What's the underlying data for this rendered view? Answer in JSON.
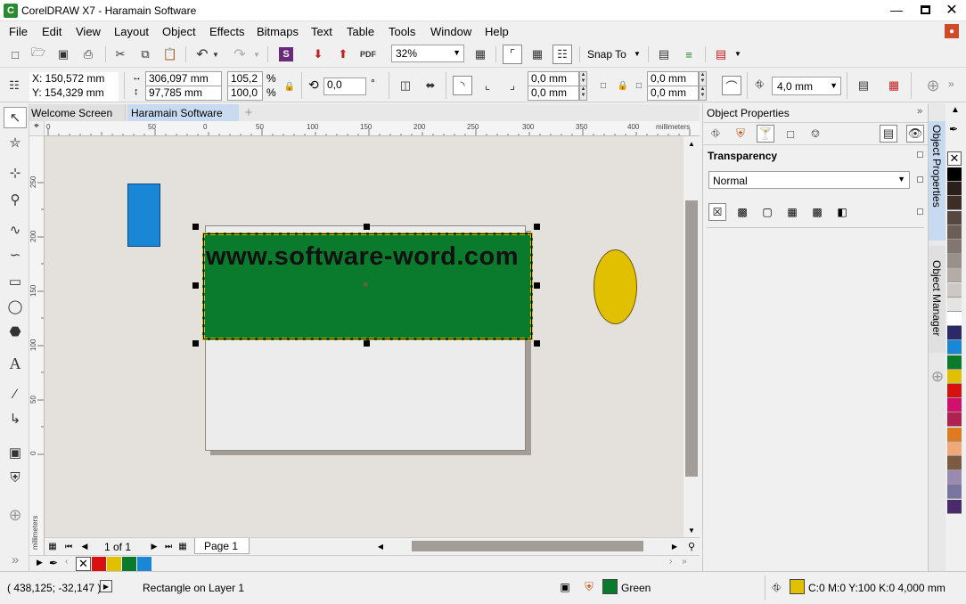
{
  "window": {
    "title": "CorelDRAW X7 - Haramain Software"
  },
  "menu": [
    "File",
    "Edit",
    "View",
    "Layout",
    "Object",
    "Effects",
    "Bitmaps",
    "Text",
    "Table",
    "Tools",
    "Window",
    "Help"
  ],
  "toolbar": {
    "zoom": "32%",
    "snap_to": "Snap To"
  },
  "propbar": {
    "x": "X: 150,572 mm",
    "y": "Y: 154,329 mm",
    "width": "306,097 mm",
    "height": "97,785 mm",
    "scale_w": "105,2",
    "scale_h": "100,0",
    "pct1": "%",
    "pct2": "%",
    "angle": "0,0",
    "deg": "°",
    "corner1": "0,0 mm",
    "corner2": "0,0 mm",
    "corner3": "0,0 mm",
    "corner4": "0,0 mm",
    "outline": "4,0 mm"
  },
  "doc_tabs": [
    "Welcome Screen",
    "Haramain Software"
  ],
  "ruler": {
    "unit": "millimeters",
    "h_ticks": [
      "0",
      "50",
      "0",
      "50",
      "100",
      "150",
      "200",
      "250",
      "300",
      "350",
      "400"
    ],
    "v_ticks": [
      "250",
      "200",
      "150",
      "100",
      "50",
      "0"
    ]
  },
  "canvas": {
    "text_object": "www.software-word.com"
  },
  "page_nav": {
    "count": "1 of 1",
    "page_tab": "Page 1"
  },
  "docker": {
    "title": "Object Properties",
    "section": "Transparency",
    "mode": "Normal",
    "side_tabs": [
      "Object Properties",
      "Object Manager"
    ]
  },
  "status": {
    "coords": "( 438,125; -32,147 )",
    "object": "Rectangle on Layer 1",
    "fill_name": "Green",
    "outline_info": "C:0 M:0 Y:100 K:0  4,000 mm"
  },
  "colors": {
    "green": "#0a7a2c",
    "blue": "#1a87d6",
    "yellow": "#e0c000",
    "red": "#d81010",
    "tab_active": "#c8daf0",
    "palette": [
      "#000000",
      "#2b1f1a",
      "#3d2f28",
      "#564840",
      "#6b5e57",
      "#827670",
      "#9a908a",
      "#b3aca7",
      "#cdc8c5",
      "#e6e4e2",
      "#ffffff",
      "#2a2a6a",
      "#1a87d6",
      "#0a7a2c",
      "#e0c000",
      "#d81010",
      "#d0106a",
      "#b02050",
      "#e07a1e",
      "#f0a878",
      "#7a5a40",
      "#9a8ab0",
      "#7a74a0",
      "#4a2a6a"
    ],
    "doc_palette": [
      "#d81010",
      "#e0c000",
      "#0a7a2c",
      "#1a87d6"
    ]
  },
  "icons": [
    "app-logo-icon",
    "minimize-icon",
    "maximize-icon",
    "close-icon",
    "pick-tool-icon",
    "zoom-tool-icon",
    "text-tool-icon",
    "fill-tool-icon",
    "add-icon"
  ]
}
